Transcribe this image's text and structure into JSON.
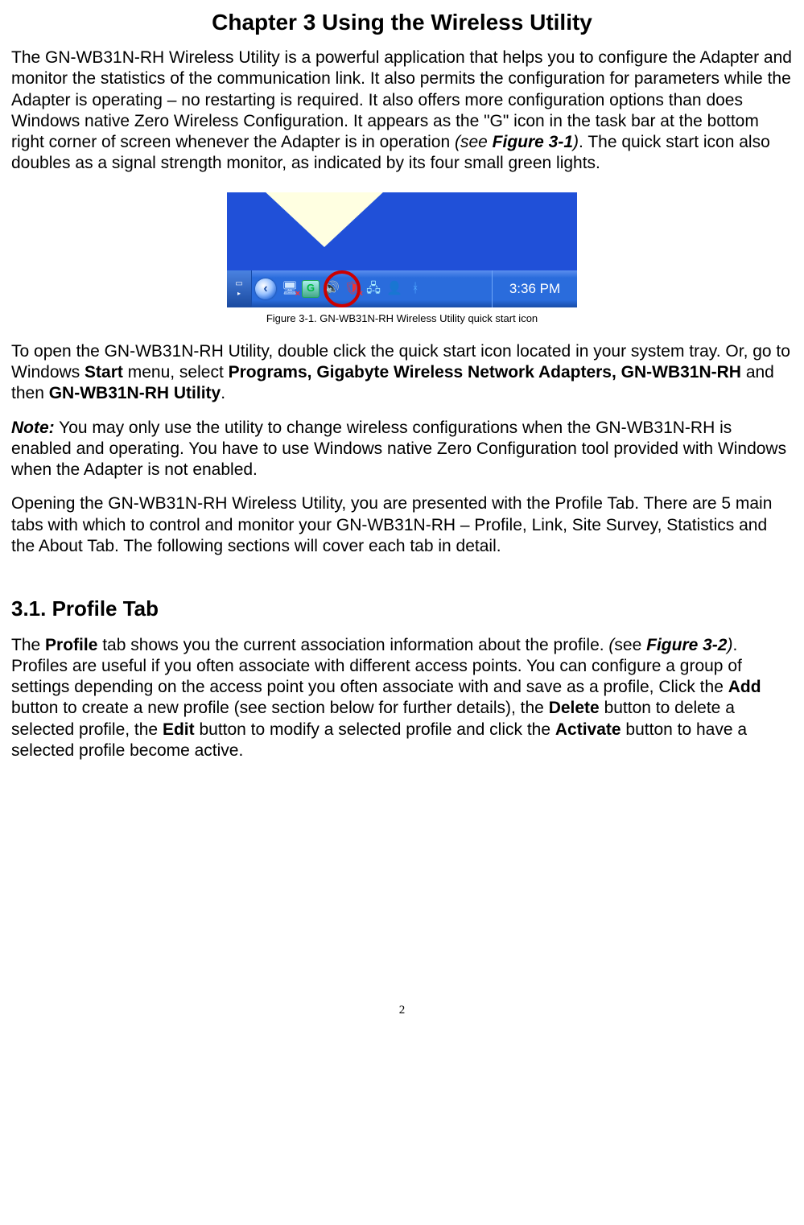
{
  "title": "Chapter 3    Using the Wireless Utility",
  "para1_a": "The GN-WB31N-RH Wireless Utility is a powerful application that helps you to configure the Adapter and monitor the statistics of the communication link. It also permits the configuration for parameters while the Adapter is operating – no restarting is required. It also offers more configuration options than does Windows native Zero Wireless Configuration. It appears as the \"G\" icon in the task bar at the bottom right corner of screen whenever the Adapter is in operation ",
  "para1_see_prefix": "(see ",
  "para1_see_ref": "Figure 3-1",
  "para1_see_suffix": ")",
  "para1_b": ". The quick start icon also doubles as a signal strength monitor, as indicated by its four small green lights.",
  "figure1_caption": "Figure 3-1.    GN-WB31N-RH Wireless Utility quick start icon",
  "clock": "3:36 PM",
  "chevron_glyph": "‹",
  "para2_a": "To open the GN-WB31N-RH Utility, double click the quick start icon located in your system tray. Or, go to Windows ",
  "para2_b1": "Start",
  "para2_c": " menu, select ",
  "para2_b2": "Programs, Gigabyte Wireless Network Adapters, GN-WB31N-RH",
  "para2_d": " and then ",
  "para2_b3": "GN-WB31N-RH Utility",
  "para2_e": ".",
  "note_label": "Note:",
  "note_text": " You may only use the utility to change wireless configurations when the GN-WB31N-RH is enabled and operating. You have to use Windows native Zero Configuration tool provided with Windows when the Adapter is not enabled.",
  "para4": "Opening the GN-WB31N-RH Wireless Utility, you are presented with the Profile Tab. There are 5 main tabs with which to control and monitor your GN-WB31N-RH – Profile, Link, Site Survey, Statistics and the About Tab. The following sections will cover each tab in detail.",
  "section_title": "3.1. Profile Tab",
  "para5_a": "The ",
  "para5_b1": "Profile",
  "para5_b": " tab shows you the current association information about the profile. ",
  "para5_see_prefix": "(",
  "para5_see_word": "see ",
  "para5_see_ref": "Figure 3-2",
  "para5_see_suffix": ")",
  "para5_c": ". Profiles are useful if you often associate with different access points.    You can configure a group of settings depending on the access point you often associate with and save as a profile, Click the ",
  "para5_b2": "Add",
  "para5_d": " button to create a new profile (see section below for further details), the ",
  "para5_b3": "Delete",
  "para5_e": " button to delete a selected profile, the ",
  "para5_b4": "Edit",
  "para5_f": " button to modify a selected profile and click the ",
  "para5_b5": "Activate",
  "para5_g": " button to have a selected profile become active.",
  "page_number": "2"
}
